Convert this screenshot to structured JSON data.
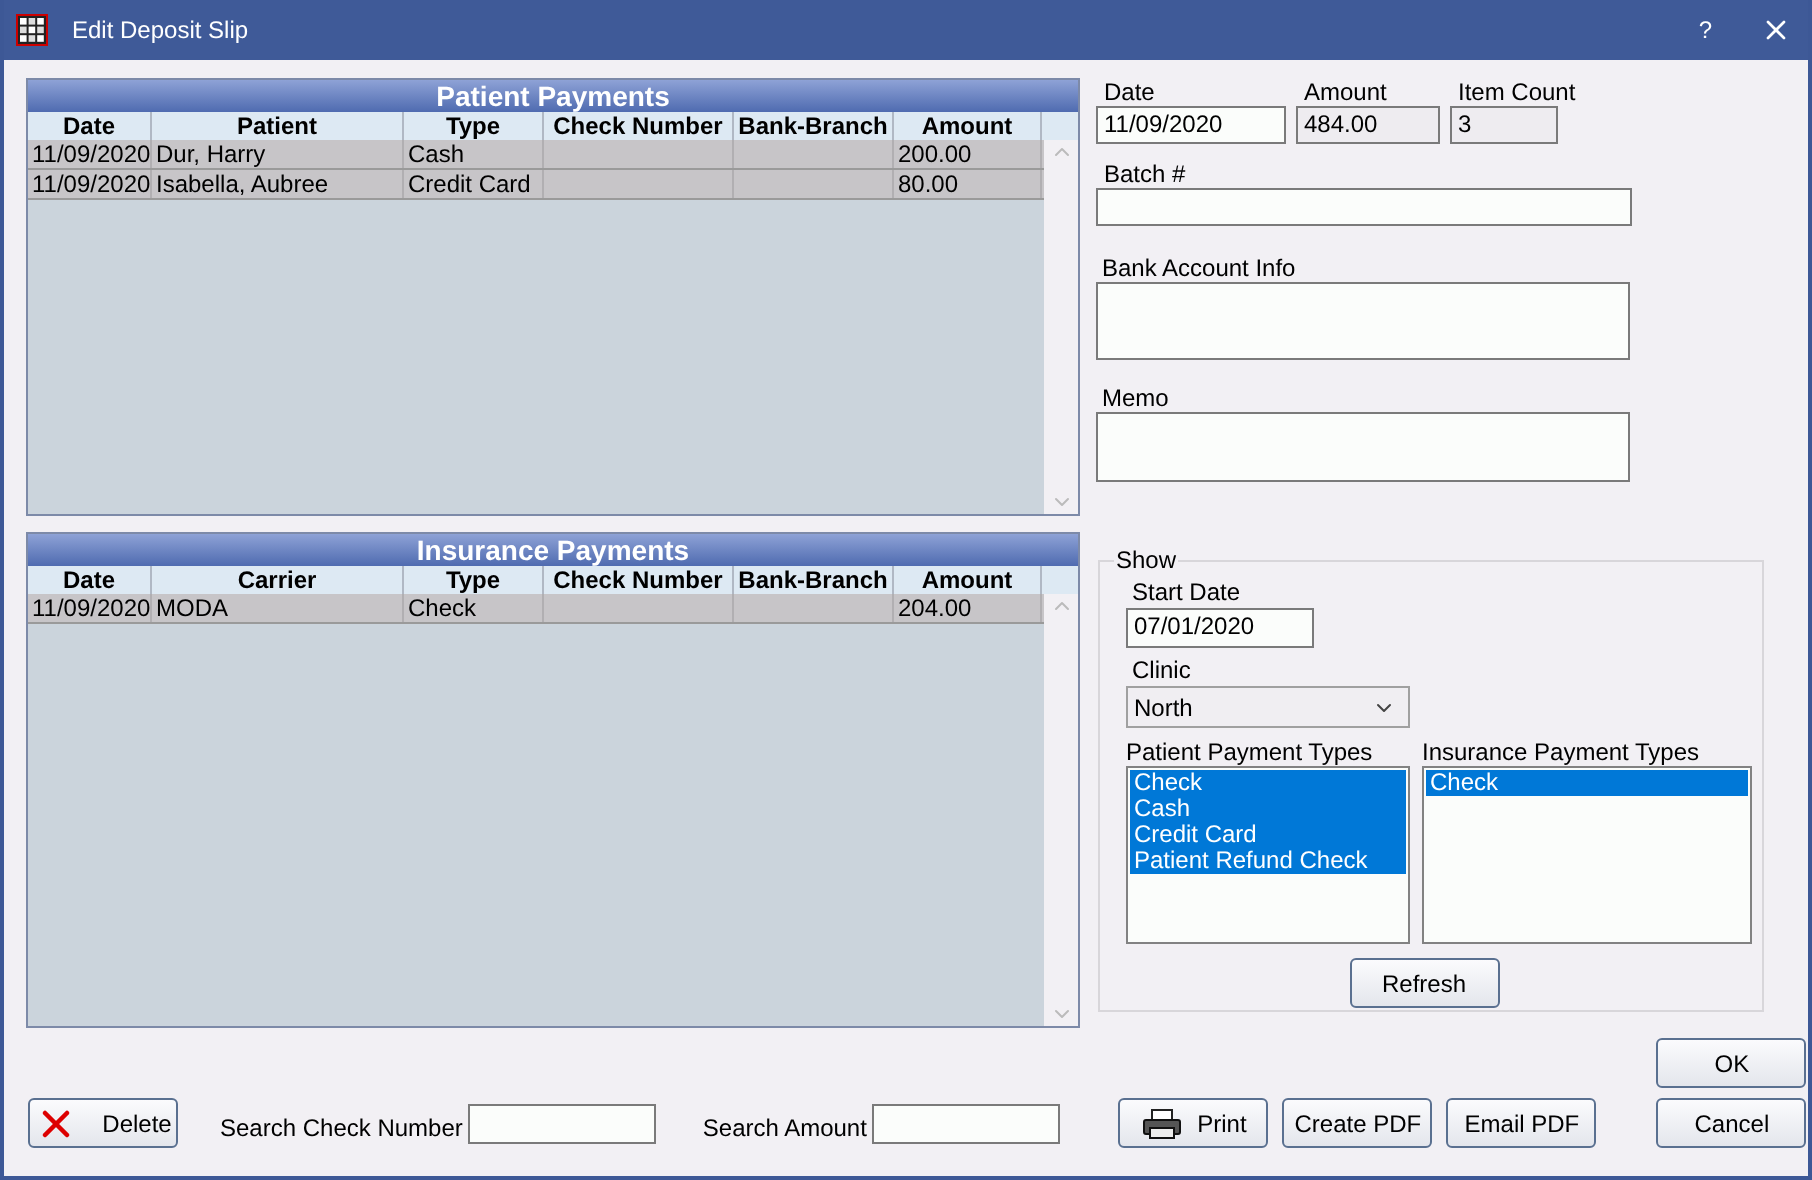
{
  "window": {
    "title": "Edit Deposit Slip",
    "help": "?"
  },
  "patient_payments": {
    "title": "Patient Payments",
    "columns": [
      "Date",
      "Patient",
      "Type",
      "Check Number",
      "Bank-Branch",
      "Amount"
    ],
    "rows": [
      {
        "cells": [
          "11/09/2020",
          "Dur, Harry",
          "Cash",
          "",
          "",
          "200.00"
        ]
      },
      {
        "cells": [
          "11/09/2020",
          "Isabella, Aubree",
          "Credit Card",
          "",
          "",
          "80.00"
        ]
      }
    ]
  },
  "insurance_payments": {
    "title": "Insurance Payments",
    "columns": [
      "Date",
      "Carrier",
      "Type",
      "Check Number",
      "Bank-Branch",
      "Amount"
    ],
    "rows": [
      {
        "cells": [
          "11/09/2020",
          "MODA",
          "Check",
          "",
          "",
          "204.00"
        ]
      }
    ]
  },
  "deposit": {
    "date": {
      "label": "Date",
      "value": "11/09/2020",
      "readonly": false
    },
    "amount": {
      "label": "Amount",
      "value": "484.00",
      "readonly": true
    },
    "item_count": {
      "label": "Item Count",
      "value": "3",
      "readonly": true
    },
    "batch": {
      "label": "Batch #"
    },
    "bank_account_info": {
      "label": "Bank Account Info"
    },
    "memo": {
      "label": "Memo"
    }
  },
  "show": {
    "legend": "Show",
    "start_date": {
      "label": "Start Date",
      "value": "07/01/2020"
    },
    "clinic": {
      "label": "Clinic",
      "value": "North"
    },
    "patient_payment_types": {
      "label": "Patient Payment Types",
      "items": [
        {
          "label": "Check",
          "selected": true
        },
        {
          "label": "Cash",
          "selected": true
        },
        {
          "label": "Credit Card",
          "selected": true
        },
        {
          "label": "Patient Refund Check",
          "selected": true
        }
      ]
    },
    "insurance_payment_types": {
      "label": "Insurance Payment Types",
      "items": [
        {
          "label": "Check",
          "selected": true
        }
      ]
    },
    "refresh": "Refresh"
  },
  "bottom": {
    "delete": "Delete",
    "search_check_number": {
      "label": "Search Check Number"
    },
    "search_amount": {
      "label": "Search Amount"
    },
    "buttons": [
      {
        "kind": "print",
        "label": "Print"
      },
      {
        "kind": "plain",
        "label": "Create PDF"
      },
      {
        "kind": "plain",
        "label": "Email PDF"
      }
    ],
    "ok": "OK",
    "cancel": "Cancel"
  }
}
